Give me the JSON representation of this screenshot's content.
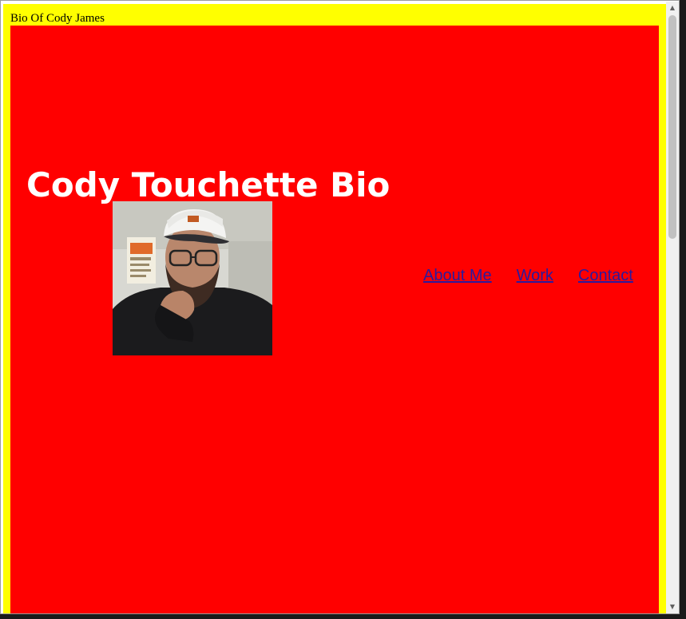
{
  "page": {
    "title": "Bio Of Cody James",
    "headline": "Cody Touchette Bio"
  },
  "portrait": {
    "alt": "Portrait of Cody Touchette"
  },
  "nav": {
    "items": [
      {
        "label": "About Me"
      },
      {
        "label": "Work"
      },
      {
        "label": "Contact"
      }
    ]
  },
  "colors": {
    "page_background": "#ffff00",
    "panel_background": "#ff0000",
    "headline_text": "#ffffff",
    "link_text": "#2a1a9e"
  },
  "icons": {
    "scroll_up": "scroll-up-arrow-icon",
    "scroll_down": "scroll-down-arrow-icon"
  }
}
